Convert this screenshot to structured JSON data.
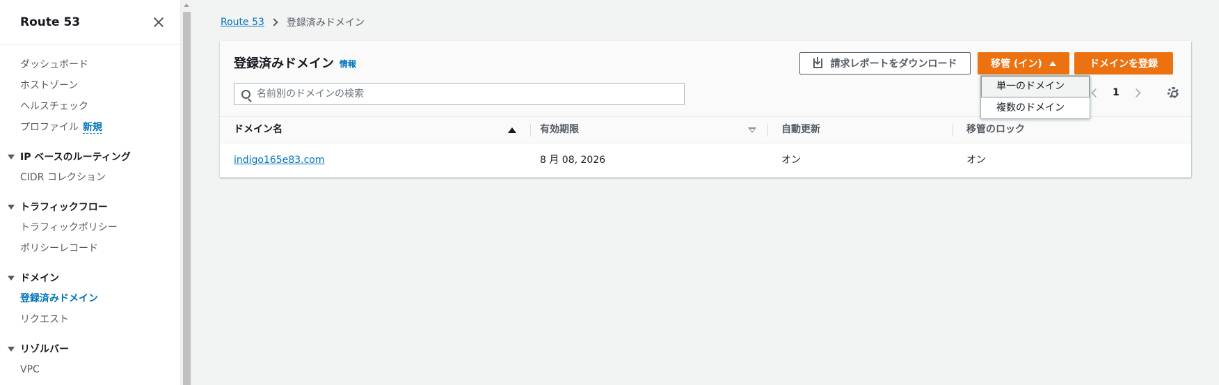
{
  "sidebar": {
    "title": "Route 53",
    "items_top": [
      "ダッシュボード",
      "ホストゾーン",
      "ヘルスチェック"
    ],
    "profile_label": "プロファイル",
    "new_badge": "新規",
    "sections": [
      {
        "label": "IP ベースのルーティング",
        "items": [
          "CIDR コレクション"
        ]
      },
      {
        "label": "トラフィックフロー",
        "items": [
          "トラフィックポリシー",
          "ポリシーレコード"
        ]
      },
      {
        "label": "ドメイン",
        "items": [
          "登録済みドメイン",
          "リクエスト"
        ]
      },
      {
        "label": "リゾルバー",
        "items": [
          "VPC"
        ]
      }
    ]
  },
  "breadcrumb": {
    "root": "Route 53",
    "current": "登録済みドメイン"
  },
  "panel": {
    "title": "登録済みドメイン",
    "info_link": "情報",
    "download_button": "請求レポートをダウンロード",
    "transfer_button": "移管 (イン)",
    "register_button": "ドメインを登録",
    "search_placeholder": "名前別のドメインの検索",
    "page_number": "1"
  },
  "table": {
    "columns": [
      "ドメイン名",
      "有効期限",
      "自動更新",
      "移管のロック"
    ],
    "rows": [
      {
        "domain": "indigo165e83.com",
        "expiry": "8 月 08, 2026",
        "auto_renew": "オン",
        "transfer_lock": "オン"
      }
    ]
  },
  "dropdown": {
    "items": [
      "単一のドメイン",
      "複数のドメイン"
    ]
  },
  "colors": {
    "primary": "#ec7211",
    "link": "#0073bb",
    "background": "#f2f3f3"
  }
}
